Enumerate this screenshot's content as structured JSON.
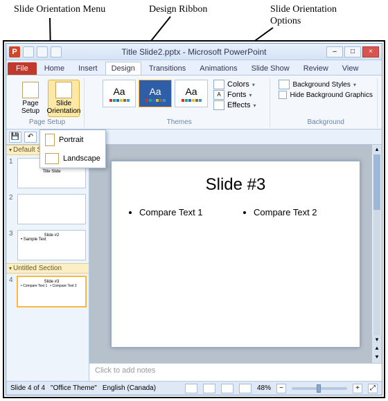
{
  "annotations": {
    "orientation_menu": "Slide Orientation Menu",
    "design_ribbon": "Design Ribbon",
    "orientation_options": "Slide Orientation\nOptions"
  },
  "titlebar": {
    "app_title": "Title Slide2.pptx - Microsoft PowerPoint",
    "p_glyph": "P"
  },
  "window": {
    "min": "–",
    "max": "□",
    "close": "×"
  },
  "tabs": {
    "file": "File",
    "home": "Home",
    "insert": "Insert",
    "design": "Design",
    "transitions": "Transitions",
    "animations": "Animations",
    "slideshow": "Slide Show",
    "review": "Review",
    "view": "View"
  },
  "ribbon": {
    "page_setup": {
      "label": "Page Setup",
      "btn_page": "Page Setup",
      "btn_orient": "Slide Orientation"
    },
    "themes": {
      "label": "Themes",
      "aa": "Aa"
    },
    "variants": {
      "colors": "Colors",
      "fonts": "Fonts",
      "effects": "Effects"
    },
    "background": {
      "label": "Background",
      "styles": "Background Styles",
      "hide": "Hide Background Graphics"
    }
  },
  "orient_menu": {
    "portrait": "Portrait",
    "landscape": "Landscape"
  },
  "thumbs": {
    "section_default": "Default Section",
    "section_untitled": "Untitled Section",
    "n1": "1",
    "n2": "2",
    "n3": "3",
    "n4": "4",
    "t1_title": "Title Slide",
    "t3_title": "Slide #2",
    "t3_b1": "• Sample Text",
    "t4_title": "Slide #3",
    "t4_b1": "• Compare Text 1",
    "t4_b2": "• Compare Text 2"
  },
  "slide": {
    "heading": "Slide #3",
    "left": "Compare Text 1",
    "right": "Compare Text 2"
  },
  "notes": {
    "placeholder": "Click to add notes"
  },
  "status": {
    "slide_of": "Slide 4 of 4",
    "theme": "\"Office Theme\"",
    "lang": "English (Canada)",
    "zoom": "48%",
    "minus": "−",
    "plus": "+",
    "fit": "⤢"
  }
}
